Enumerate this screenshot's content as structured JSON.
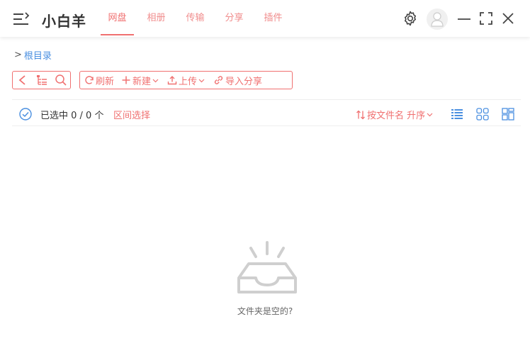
{
  "app": {
    "title": "小白羊"
  },
  "tabs": [
    {
      "label": "网盘",
      "active": true
    },
    {
      "label": "相册",
      "active": false
    },
    {
      "label": "传输",
      "active": false
    },
    {
      "label": "分享",
      "active": false
    },
    {
      "label": "插件",
      "active": false
    }
  ],
  "header_icons": [
    "menu-icon",
    "settings-icon",
    "user-avatar",
    "minimize-icon",
    "fullscreen-icon",
    "close-icon"
  ],
  "breadcrumb": {
    "separator": ">",
    "root": "根目录"
  },
  "toolbar": {
    "nav_icons": [
      "back-icon",
      "tree-icon",
      "search-icon"
    ],
    "refresh": "刷新",
    "new": "新建",
    "upload": "上传",
    "import_share": "导入分享"
  },
  "selection": {
    "count_text": "已选中 0 / 0 个",
    "range_select": "区间选择",
    "sort_label": "按文件名 升序"
  },
  "view_modes": [
    "list-view-icon",
    "grid-view-icon",
    "large-grid-view-icon"
  ],
  "empty": {
    "message": "文件夹是空的?"
  },
  "colors": {
    "accent": "#f07070",
    "link": "#4a8fe0",
    "icon_gray": "#c8c8c8"
  }
}
